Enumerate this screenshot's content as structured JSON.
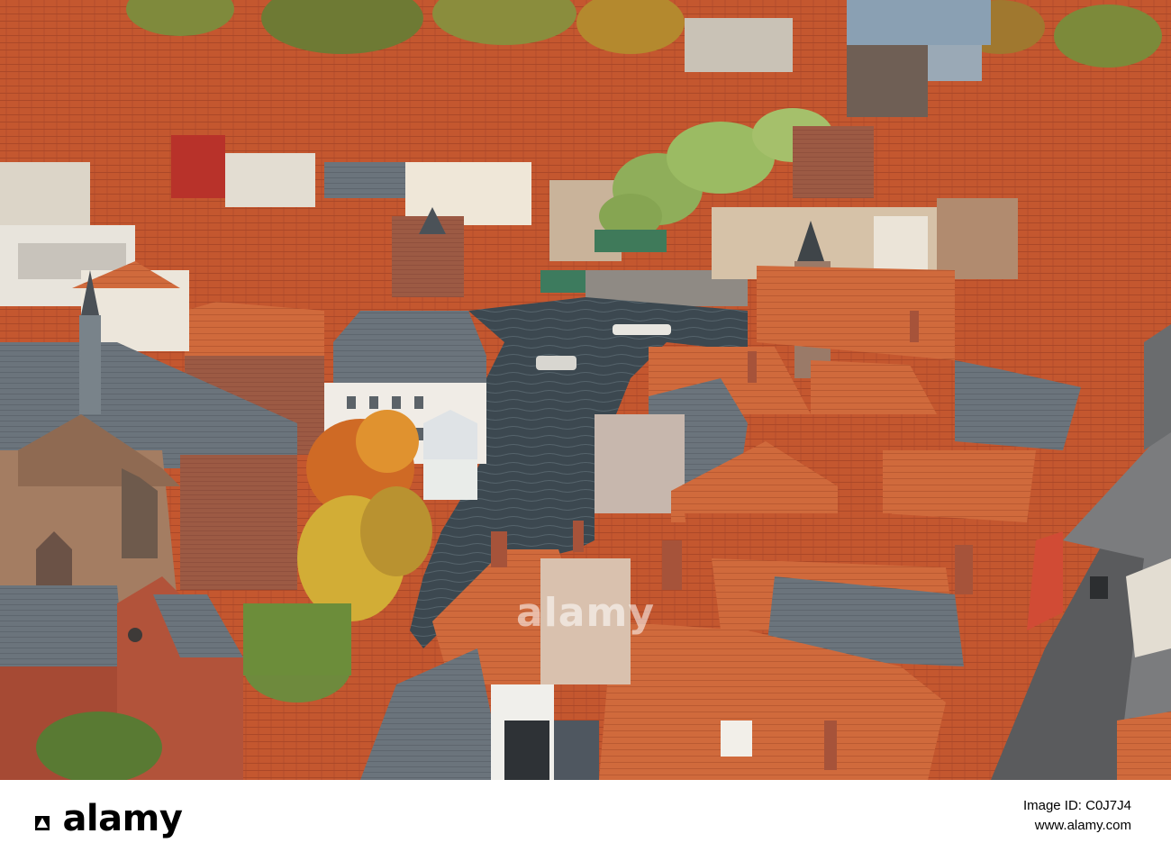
{
  "photo": {
    "watermark_text": "alamy",
    "subject": "aerial view of old town with canal, red tile roofs and autumn trees",
    "colors": {
      "roof": "#c4572f",
      "roof_dark": "#9a3f22",
      "slate": "#6f7880",
      "canal": "#3d4a52",
      "tree_green": "#8fae5a",
      "tree_orange": "#d8792a",
      "tree_yellow": "#d7b43a",
      "facade": "#e9e2d6"
    }
  },
  "footer": {
    "logo_text": "alamy",
    "image_id_label": "Image ID: C0J7J4",
    "site_url": "www.alamy.com"
  }
}
